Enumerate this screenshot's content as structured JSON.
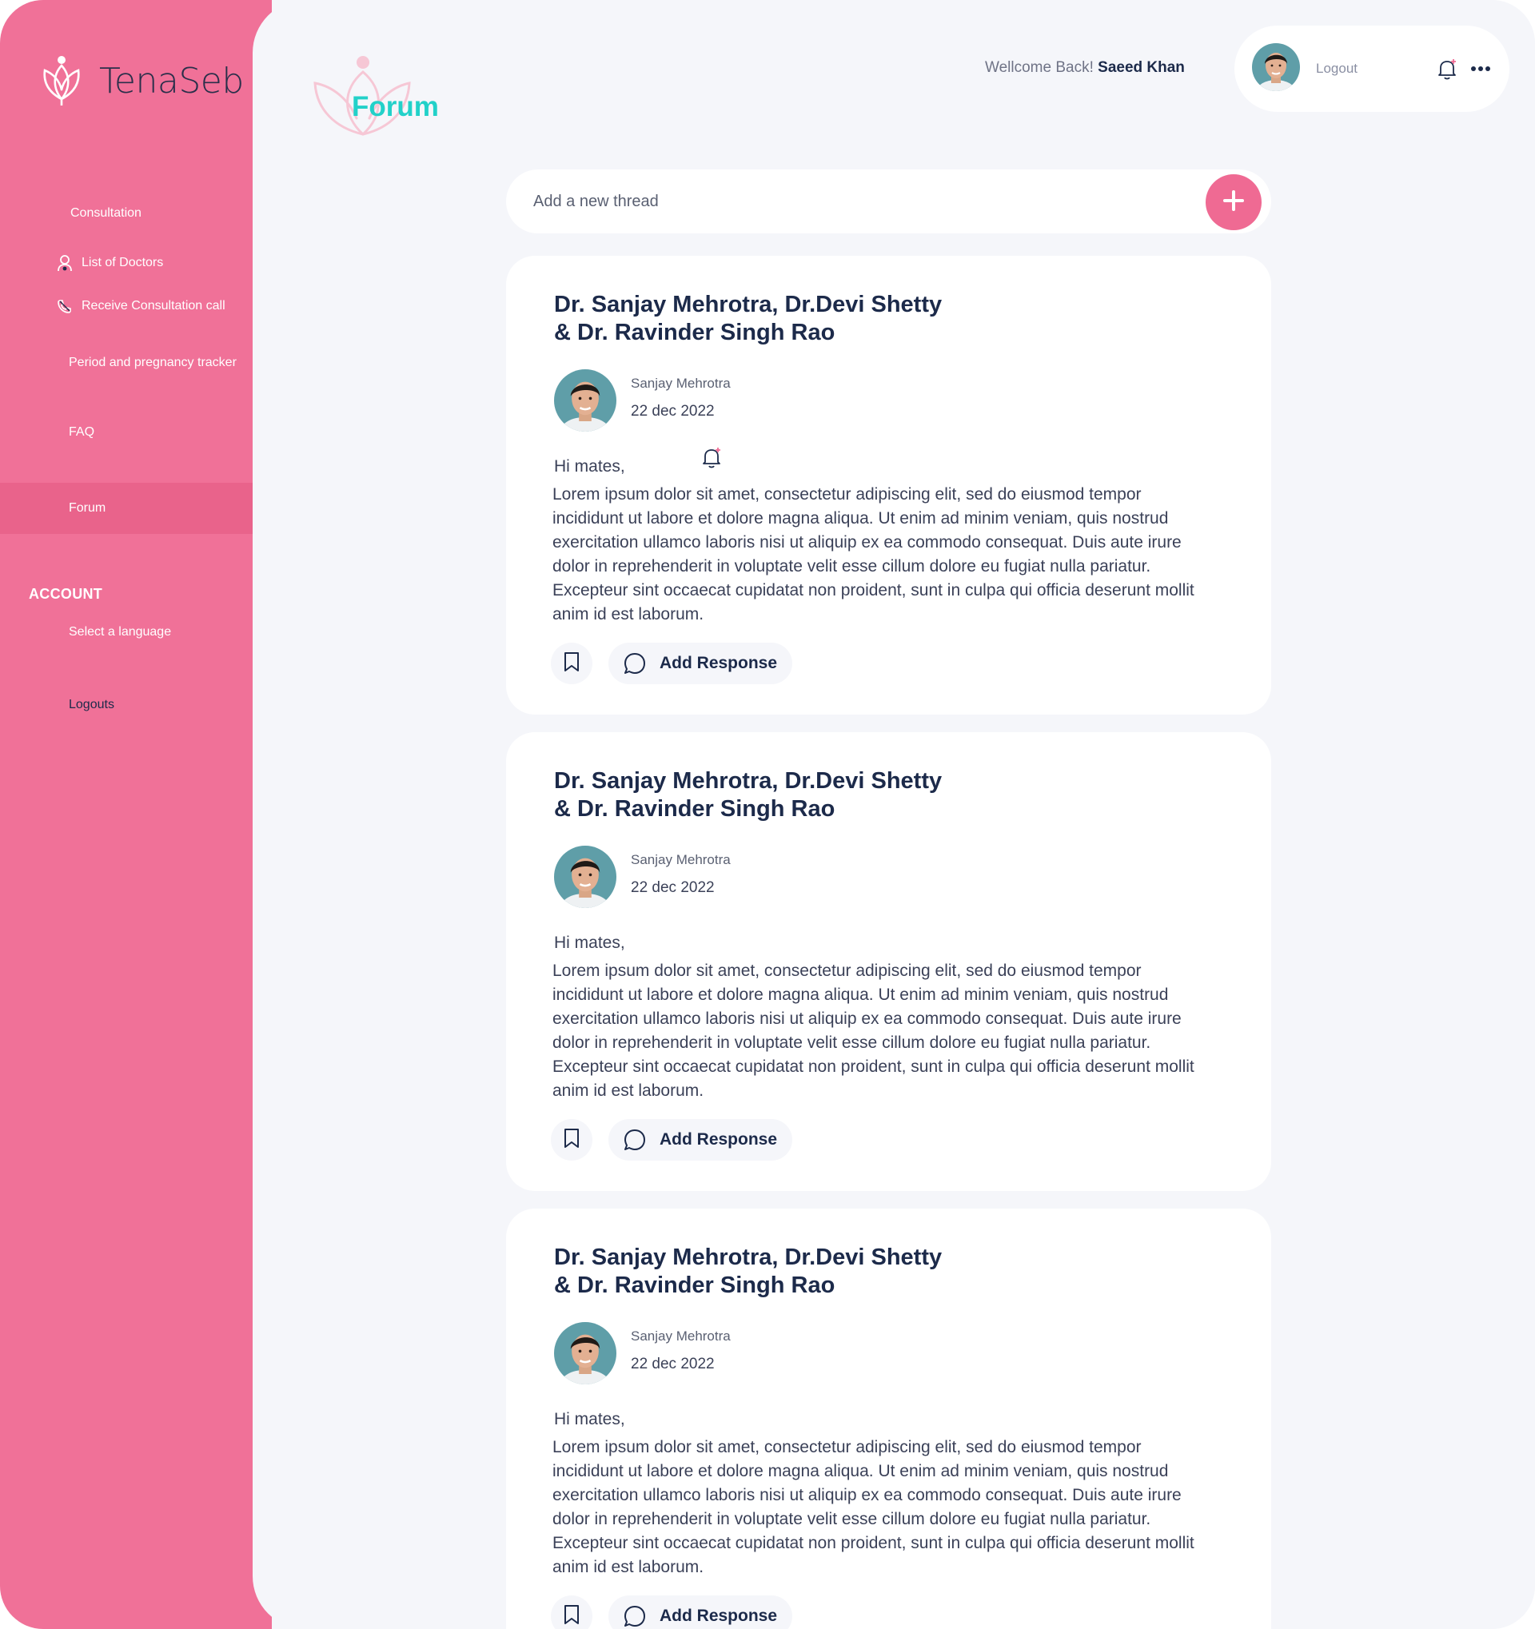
{
  "brand": {
    "name": "TenaSeb"
  },
  "sidebar": {
    "items": [
      {
        "label": "Consultation"
      },
      {
        "label": "List of Doctors"
      },
      {
        "label": "Receive Consultation call"
      },
      {
        "label": "Period and pregnancy tracker"
      },
      {
        "label": "FAQ"
      },
      {
        "label": "Forum"
      }
    ],
    "account_heading": "ACCOUNT",
    "account_items": [
      {
        "label": "Select a language"
      },
      {
        "label": "Logouts"
      }
    ]
  },
  "header": {
    "page_title": "Forum",
    "welcome_prefix": "Wellcome Back!",
    "user_name": "Saeed Khan",
    "logout_label": "Logout"
  },
  "thread_input": {
    "placeholder": "Add a new thread"
  },
  "posts": [
    {
      "title_line1": "Dr. Sanjay Mehrotra, Dr.Devi Shetty",
      "title_line2": "& Dr. Ravinder Singh Rao",
      "author": "Sanjay Mehrotra",
      "date": "22 dec 2022",
      "greeting": "Hi mates,",
      "body": "Lorem ipsum dolor sit amet, consectetur adipiscing elit, sed do eiusmod tempor incididunt ut labore et dolore magna aliqua. Ut enim ad minim veniam, quis nostrud exercitation ullamco laboris nisi ut aliquip ex ea commodo consequat. Duis aute irure dolor in reprehenderit in voluptate velit esse cillum dolore eu fugiat nulla pariatur. Excepteur sint occaecat cupidatat non proident, sunt in culpa qui officia deserunt mollit anim id est laborum.",
      "response_label": "Add Response"
    },
    {
      "title_line1": "Dr. Sanjay Mehrotra, Dr.Devi Shetty",
      "title_line2": "& Dr. Ravinder Singh Rao",
      "author": "Sanjay Mehrotra",
      "date": "22 dec 2022",
      "greeting": "Hi mates,",
      "body": "Lorem ipsum dolor sit amet, consectetur adipiscing elit, sed do eiusmod tempor incididunt ut labore et dolore magna aliqua. Ut enim ad minim veniam, quis nostrud exercitation ullamco laboris nisi ut aliquip ex ea commodo consequat. Duis aute irure dolor in reprehenderit in voluptate velit esse cillum dolore eu fugiat nulla pariatur. Excepteur sint occaecat cupidatat non proident, sunt in culpa qui officia deserunt mollit anim id est laborum.",
      "response_label": "Add Response"
    },
    {
      "title_line1": "Dr. Sanjay Mehrotra, Dr.Devi Shetty",
      "title_line2": "& Dr. Ravinder Singh Rao",
      "author": "Sanjay Mehrotra",
      "date": "22 dec 2022",
      "greeting": "Hi mates,",
      "body": "Lorem ipsum dolor sit amet, consectetur adipiscing elit, sed do eiusmod tempor incididunt ut labore et dolore magna aliqua. Ut enim ad minim veniam, quis nostrud exercitation ullamco laboris nisi ut aliquip ex ea commodo consequat. Duis aute irure dolor in reprehenderit in voluptate velit esse cillum dolore eu fugiat nulla pariatur. Excepteur sint occaecat cupidatat non proident, sunt in culpa qui officia deserunt mollit anim id est laborum.",
      "response_label": "Add Response"
    }
  ],
  "colors": {
    "sidebar": "#f07198",
    "sidebar_active": "#e9638b",
    "accent_teal": "#22d1c9",
    "add_button": "#ef6a93",
    "text_dark": "#1c2a4a",
    "background": "#f5f6fa"
  },
  "icons": {
    "brand_logo": "lotus-logo-icon",
    "list_of_doctors": "doctor-icon",
    "receive_call": "phone-icon",
    "notifications": "bell-icon",
    "more": "more-dots-icon",
    "add_thread": "plus-icon",
    "bookmark": "bookmark-icon",
    "response": "chat-bubble-icon"
  }
}
